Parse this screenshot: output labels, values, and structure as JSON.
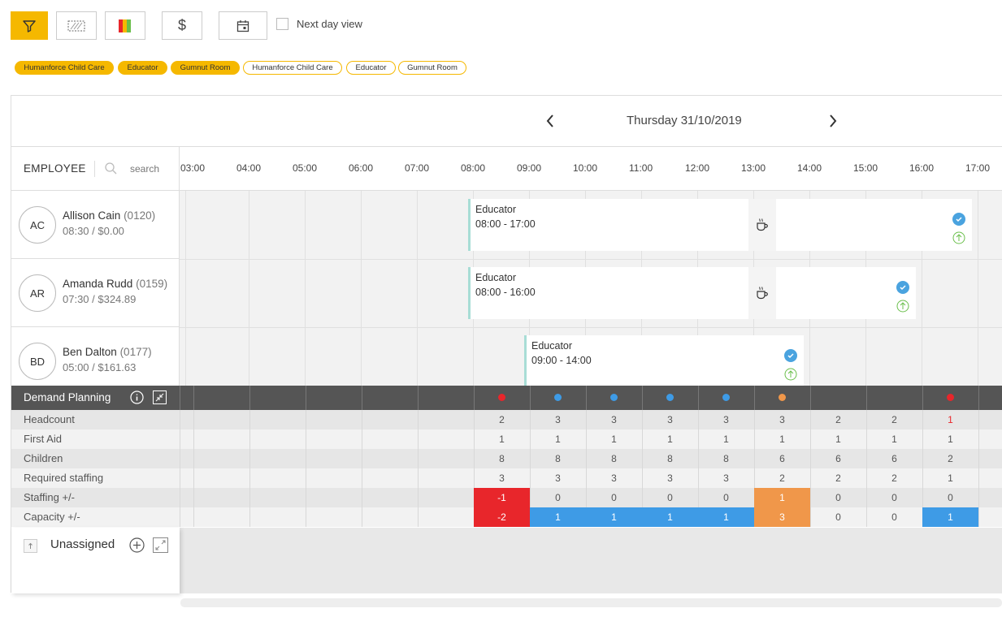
{
  "toolbar": {
    "buttons": [
      {
        "icon": "filter-icon",
        "active": true
      },
      {
        "icon": "pattern-icon",
        "active": false
      },
      {
        "icon": "color-bars-icon",
        "active": false
      },
      {
        "icon": "dollar-icon",
        "label": "$",
        "active": false
      },
      {
        "icon": "calendar-icon",
        "active": false
      }
    ],
    "next_day_label": "Next day view"
  },
  "chips": [
    {
      "label": "Humanforce Child Care",
      "filled": true
    },
    {
      "label": "Educator",
      "filled": true
    },
    {
      "label": "Gumnut Room",
      "filled": true
    },
    {
      "label": "Humanforce Child Care",
      "filled": false
    },
    {
      "label": "Educator",
      "filled": false
    },
    {
      "label": "Gumnut Room",
      "filled": false
    }
  ],
  "date": {
    "label": "Thursday 31/10/2019"
  },
  "header": {
    "employee_label": "EMPLOYEE",
    "search_placeholder": "search"
  },
  "hours": [
    "03:00",
    "04:00",
    "05:00",
    "06:00",
    "07:00",
    "08:00",
    "09:00",
    "10:00",
    "11:00",
    "12:00",
    "13:00",
    "14:00",
    "15:00",
    "16:00",
    "17:00"
  ],
  "employees": [
    {
      "initials": "AC",
      "name": "Allison Cain",
      "code": "(0120)",
      "hours": "08:30 / $0.00",
      "shift": {
        "role": "Educator",
        "time": "08:00 - 17:00"
      }
    },
    {
      "initials": "AR",
      "name": "Amanda Rudd",
      "code": "(0159)",
      "hours": "07:30 / $324.89",
      "shift": {
        "role": "Educator",
        "time": "08:00 - 16:00"
      }
    },
    {
      "initials": "BD",
      "name": "Ben Dalton",
      "code": "(0177)",
      "hours": "05:00 / $161.63",
      "shift": {
        "role": "Educator",
        "time": "09:00 - 14:00"
      }
    }
  ],
  "demand": {
    "title": "Demand Planning",
    "dots": [
      "#e8262b",
      "#3e9be6",
      "#3e9be6",
      "#3e9be6",
      "#3e9be6",
      "#f0974a",
      "",
      "",
      "#e8262b"
    ],
    "rows": [
      {
        "label": "Headcount",
        "values": [
          "2",
          "3",
          "3",
          "3",
          "3",
          "3",
          "2",
          "2",
          "1"
        ],
        "styles": [
          "",
          "",
          "",
          "",
          "",
          "",
          "",
          "",
          "redtext"
        ]
      },
      {
        "label": "First Aid",
        "values": [
          "1",
          "1",
          "1",
          "1",
          "1",
          "1",
          "1",
          "1",
          "1"
        ],
        "styles": [
          "",
          "",
          "",
          "",
          "",
          "",
          "",
          "",
          ""
        ]
      },
      {
        "label": "Children",
        "values": [
          "8",
          "8",
          "8",
          "8",
          "8",
          "6",
          "6",
          "6",
          "2"
        ],
        "styles": [
          "",
          "",
          "",
          "",
          "",
          "",
          "",
          "",
          ""
        ]
      },
      {
        "label": "Required staffing",
        "values": [
          "3",
          "3",
          "3",
          "3",
          "3",
          "2",
          "2",
          "2",
          "1"
        ],
        "styles": [
          "",
          "",
          "",
          "",
          "",
          "",
          "",
          "",
          ""
        ]
      },
      {
        "label": "Staffing +/-",
        "values": [
          "-1",
          "0",
          "0",
          "0",
          "0",
          "1",
          "0",
          "0",
          "0"
        ],
        "styles": [
          "red",
          "",
          "",
          "",
          "",
          "orange",
          "",
          "",
          ""
        ]
      },
      {
        "label": "Capacity +/-",
        "values": [
          "-2",
          "1",
          "1",
          "1",
          "1",
          "3",
          "0",
          "0",
          "1"
        ],
        "styles": [
          "red",
          "blue",
          "blue",
          "blue",
          "blue",
          "orange",
          "",
          "",
          "blue"
        ]
      }
    ]
  },
  "unassigned": {
    "label": "Unassigned"
  }
}
